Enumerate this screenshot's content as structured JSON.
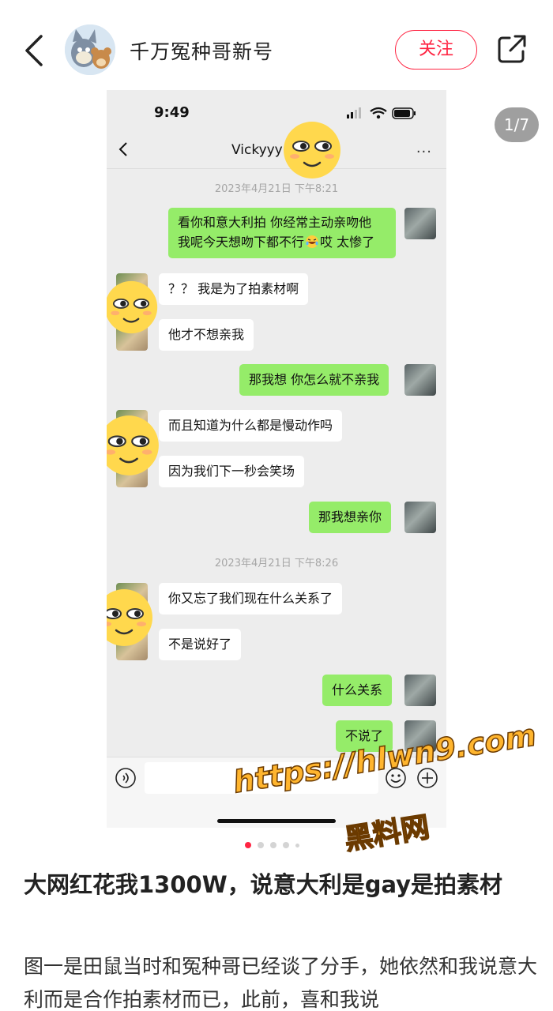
{
  "header": {
    "author_name": "千万冤种哥新号",
    "follow_label": "关注"
  },
  "gallery": {
    "counter": "1/7",
    "dots_total": 5,
    "dots_active": 0
  },
  "chat": {
    "status_time": "9:49",
    "contact_name": "Vickyyy",
    "more": "···",
    "messages": [
      {
        "type": "timestamp",
        "text": "2023年4月21日 下午8:21"
      },
      {
        "type": "out",
        "line1": "看你和意大利拍 你经常主动亲吻他",
        "line2": "我呢今天想吻下都不行",
        "line2_tail": "哎 太惨了"
      },
      {
        "type": "in",
        "text": "？？ 我是为了拍素材啊"
      },
      {
        "type": "in",
        "text": "他才不想亲我"
      },
      {
        "type": "out",
        "text": "那我想 你怎么就不亲我"
      },
      {
        "type": "in",
        "text": "而且知道为什么都是慢动作吗"
      },
      {
        "type": "in",
        "text": "因为我们下一秒会笑场"
      },
      {
        "type": "out",
        "text": "那我想亲你"
      },
      {
        "type": "timestamp",
        "text": "2023年4月21日 下午8:26"
      },
      {
        "type": "in",
        "text": "你又忘了我们现在什么关系了"
      },
      {
        "type": "in",
        "text": "不是说好了"
      },
      {
        "type": "out",
        "text": "什么关系"
      },
      {
        "type": "out",
        "text": "不说了"
      }
    ]
  },
  "watermark": {
    "url": "https://hlwn9.com",
    "name": "黑料网"
  },
  "post": {
    "title": "大网红花我1300W，说意大利是gay是拍素材",
    "body": "图一是田鼠当时和冤种哥已经谈了分手，她依然和我说意大利而是合作拍素材而已，此前，喜和我说"
  },
  "colors": {
    "accent": "#ff2442",
    "wechat_green": "#95ec69",
    "chat_bg": "#ededed"
  }
}
